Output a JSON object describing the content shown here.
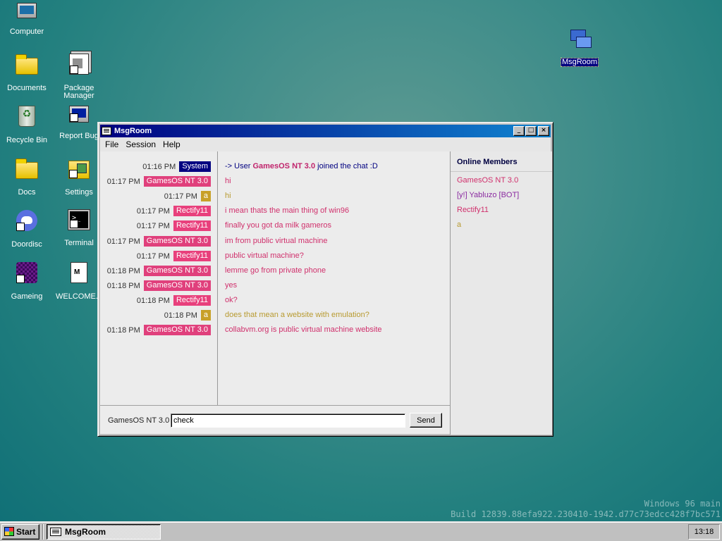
{
  "desktop": {
    "icons": [
      {
        "label": "Computer",
        "icon": "computer-icon"
      },
      {
        "label": "Documents",
        "icon": "folder-icon"
      },
      {
        "label": "Package Manager",
        "icon": "package-icon"
      },
      {
        "label": "Recycle Bin",
        "icon": "recycle-bin-icon"
      },
      {
        "label": "Report Bug",
        "icon": "report-bug-icon"
      },
      {
        "label": "Docs",
        "icon": "folder-icon"
      },
      {
        "label": "Settings",
        "icon": "settings-icon"
      },
      {
        "label": "Doordisc",
        "icon": "discord-icon"
      },
      {
        "label": "Terminal",
        "icon": "terminal-icon"
      },
      {
        "label": "Gameing",
        "icon": "game-icon"
      },
      {
        "label": "WELCOME...",
        "icon": "document-icon"
      },
      {
        "label": "MsgRoom",
        "icon": "msgroom-icon"
      }
    ]
  },
  "window": {
    "title": "MsgRoom",
    "buttons": {
      "minimize": "_",
      "maximize": "□",
      "close": "×"
    },
    "menu": [
      "File",
      "Session",
      "Help"
    ]
  },
  "chat": {
    "messages": [
      {
        "time": "01:16 PM",
        "nick": "System",
        "nick_color": "#000080",
        "pre": "-> User ",
        "bold": "GamesOS NT 3.0",
        "post": " joined the chat :D",
        "text_color": "#000080",
        "bold_color": "#c0246c"
      },
      {
        "time": "01:17 PM",
        "nick": "GamesOS NT 3.0",
        "nick_color": "#e0407c",
        "text": "hi",
        "text_color": "#d0306c"
      },
      {
        "time": "01:17 PM",
        "nick": "a",
        "nick_color": "#c8a028",
        "text": "hi",
        "text_color": "#b89a30"
      },
      {
        "time": "01:17 PM",
        "nick": "Rectify11",
        "nick_color": "#e8407c",
        "text": "i mean thats the main thing of win96",
        "text_color": "#d0306c"
      },
      {
        "time": "01:17 PM",
        "nick": "Rectify11",
        "nick_color": "#e8407c",
        "text": "finally you got da milk gameros",
        "text_color": "#d0306c"
      },
      {
        "time": "01:17 PM",
        "nick": "GamesOS NT 3.0",
        "nick_color": "#e0407c",
        "text": "im from public virtual machine",
        "text_color": "#d0306c"
      },
      {
        "time": "01:17 PM",
        "nick": "Rectify11",
        "nick_color": "#e8407c",
        "text": "public virtual machine?",
        "text_color": "#d0306c"
      },
      {
        "time": "01:18 PM",
        "nick": "GamesOS NT 3.0",
        "nick_color": "#e0407c",
        "text": "lemme go from private phone",
        "text_color": "#d0306c"
      },
      {
        "time": "01:18 PM",
        "nick": "GamesOS NT 3.0",
        "nick_color": "#e0407c",
        "text": "yes",
        "text_color": "#d0306c"
      },
      {
        "time": "01:18 PM",
        "nick": "Rectify11",
        "nick_color": "#e8407c",
        "text": "ok?",
        "text_color": "#d0306c"
      },
      {
        "time": "01:18 PM",
        "nick": "a",
        "nick_color": "#c8a028",
        "text": "does that mean a website with emulation?",
        "text_color": "#b89a30"
      },
      {
        "time": "01:18 PM",
        "nick": "GamesOS NT 3.0",
        "nick_color": "#e0407c",
        "text": "collabvm.org is public virtual machine website",
        "text_color": "#d0306c"
      }
    ]
  },
  "members": {
    "title": "Online Members",
    "list": [
      {
        "name": "GamesOS NT 3.0",
        "color": "#d0306c"
      },
      {
        "name": "[y!] Yabluzo [BOT]",
        "color": "#8a2aa0"
      },
      {
        "name": "Rectify11",
        "color": "#d0306c"
      },
      {
        "name": "a",
        "color": "#b89a30"
      }
    ]
  },
  "input": {
    "username": "GamesOS NT 3.0",
    "value": "check",
    "send_label": "Send"
  },
  "taskbar": {
    "start_label": "Start",
    "task_label": "MsgRoom",
    "clock": "13:18"
  },
  "watermark": {
    "line1": "Windows 96 main",
    "line2": "Build 12839.88efa922.230410-1942.d77c73edcc428f7bc571"
  }
}
